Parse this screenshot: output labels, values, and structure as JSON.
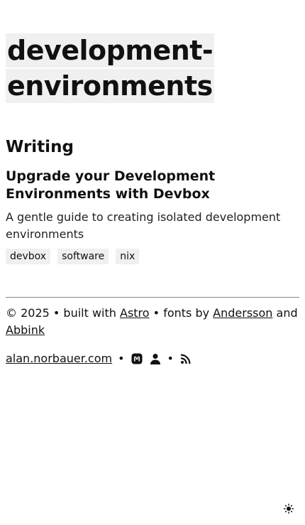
{
  "page": {
    "tag_title": "development-environments",
    "section_heading": "Writing"
  },
  "posts": [
    {
      "title": "Upgrade your Development Environments with Devbox",
      "description": "A gentle guide to creating isolated development environments",
      "tags": [
        "devbox",
        "software",
        "nix"
      ]
    }
  ],
  "footer": {
    "copyright_prefix": "© 2025 • built with ",
    "astro_link": "Astro",
    "fonts_text": " • fonts by ",
    "andersson_link": "Andersson",
    "and_text": " and ",
    "abbink_link": "Abbink",
    "site_link": "alan.norbauer.com",
    "bullet": "•",
    "icons": [
      "mastodon-icon",
      "person-icon",
      "rss-icon"
    ]
  },
  "theme_toggle": {
    "icon": "sun-icon"
  }
}
